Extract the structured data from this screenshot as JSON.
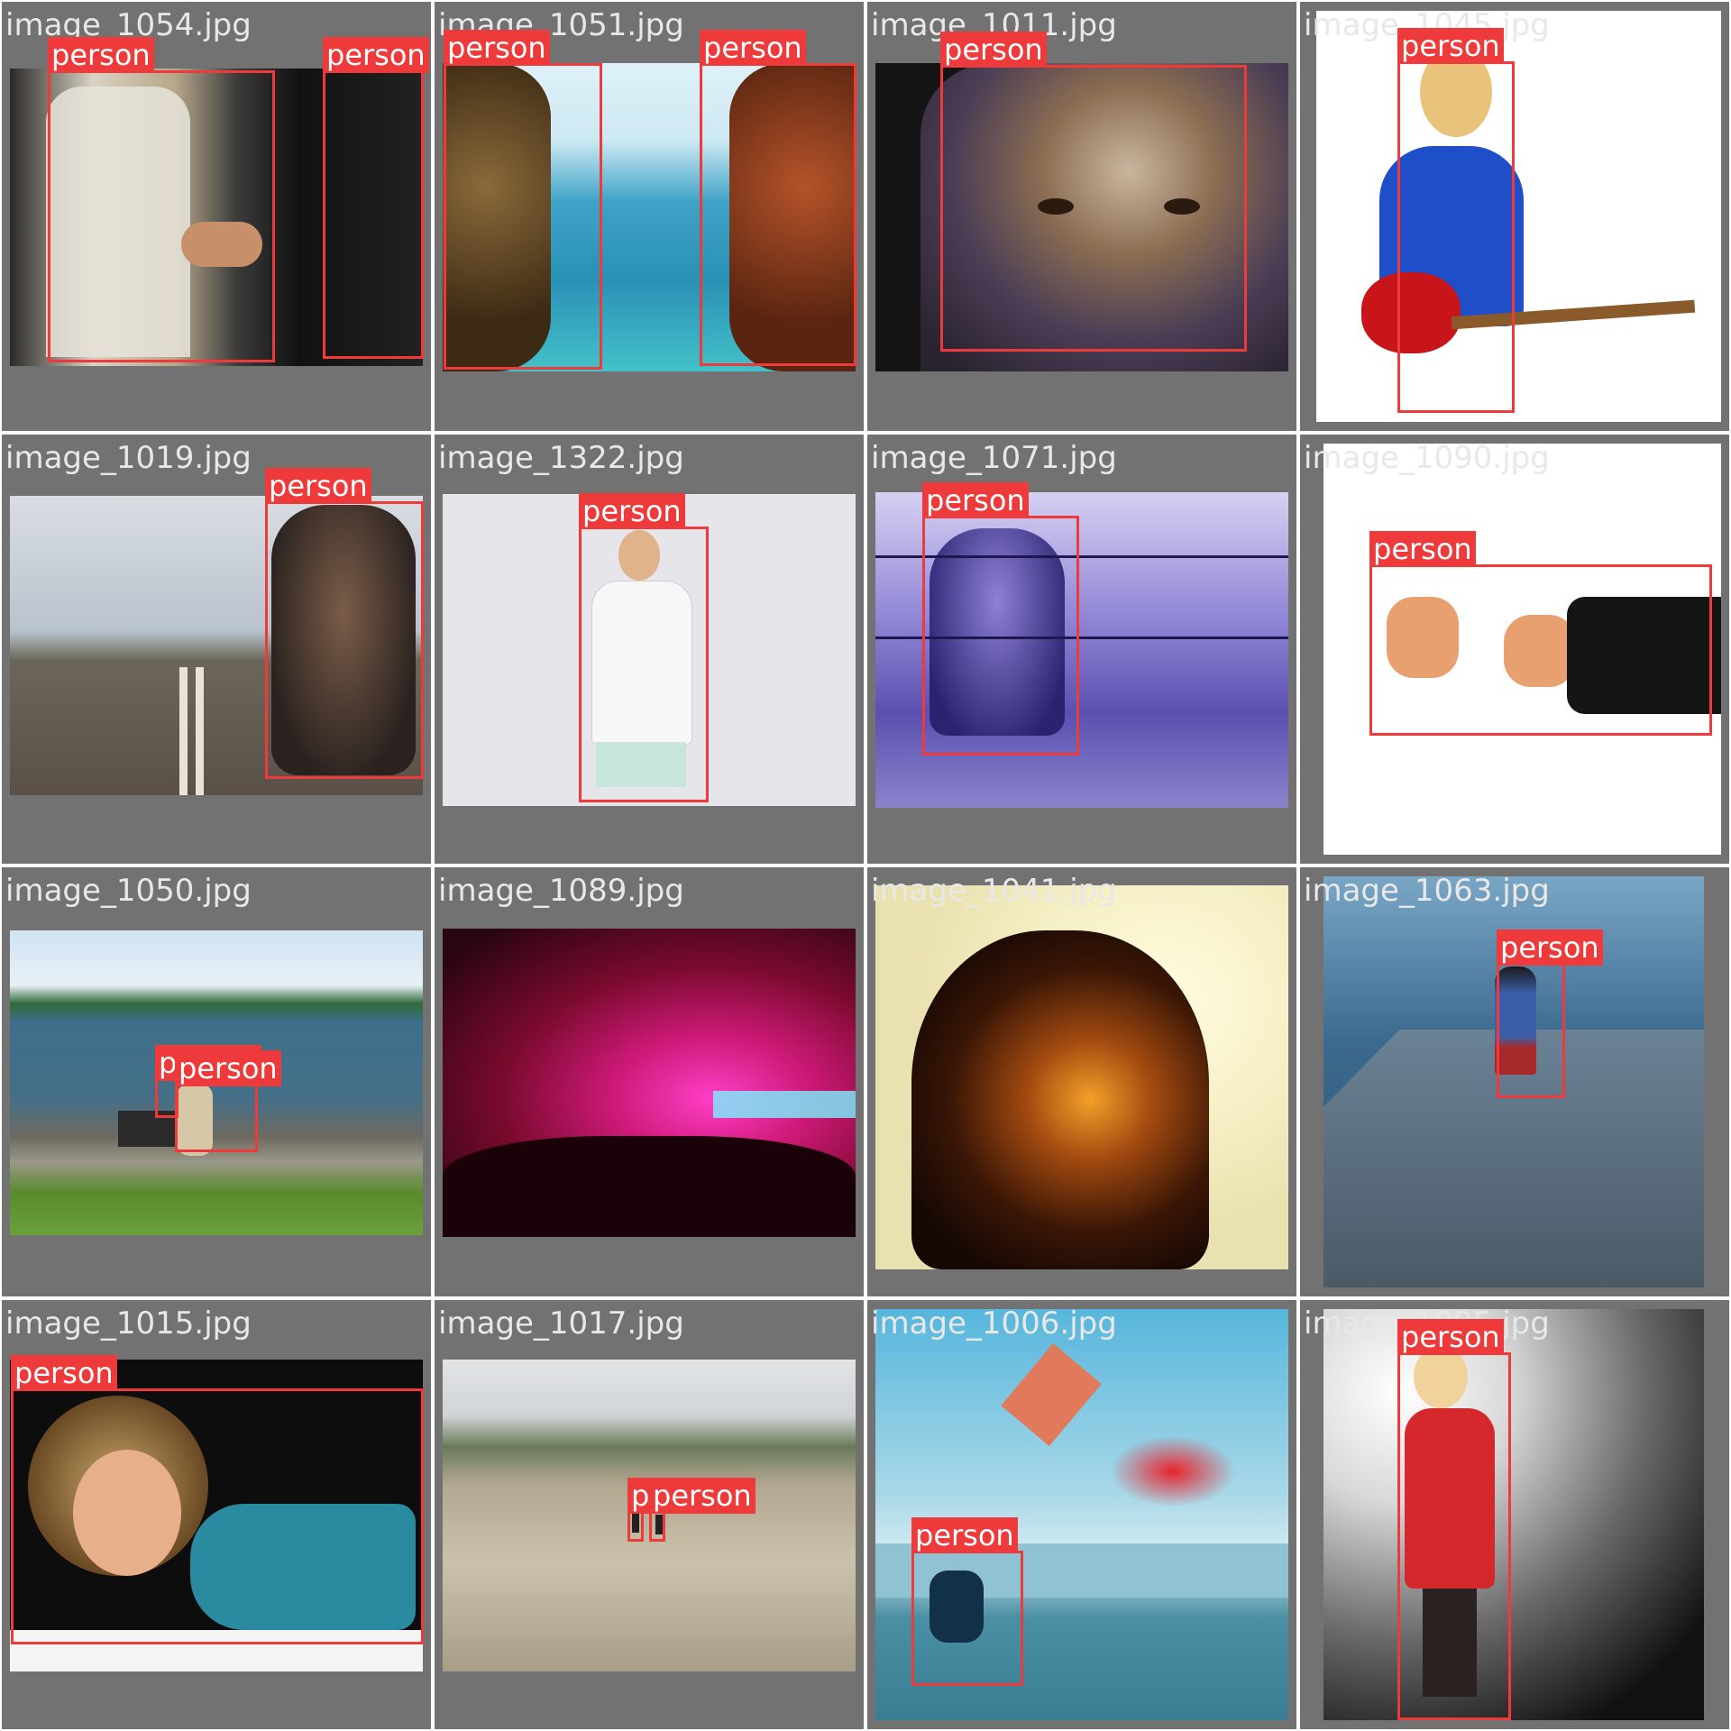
{
  "class_label": "person",
  "colors": {
    "tile_bg": "#727272",
    "box": "#ee3a3a",
    "label_text": "#ffffff",
    "filename_text": "#e8e8e8"
  },
  "tiles": [
    {
      "filename": "image_1054.jpg",
      "scene": "handshake office",
      "detections": [
        "person",
        "person"
      ]
    },
    {
      "filename": "image_1051.jpg",
      "scene": "two heads by the sea",
      "detections": [
        "person",
        "person"
      ]
    },
    {
      "filename": "image_1011.jpg",
      "scene": "veiled face",
      "detections": [
        "person"
      ]
    },
    {
      "filename": "image_1045.jpg",
      "scene": "woman with red guitar",
      "detections": [
        "person"
      ]
    },
    {
      "filename": "image_1019.jpg",
      "scene": "athlete on road",
      "detections": [
        "person"
      ]
    },
    {
      "filename": "image_1322.jpg",
      "scene": "man in white t-shirt",
      "detections": [
        "person"
      ]
    },
    {
      "filename": "image_1071.jpg",
      "scene": "boy behind barbed wire",
      "detections": [
        "person"
      ]
    },
    {
      "filename": "image_1090.jpg",
      "scene": "thumbs up hands",
      "detections": [
        "person"
      ]
    },
    {
      "filename": "image_1050.jpg",
      "scene": "bench by the bay",
      "detections": [
        "person",
        "person"
      ]
    },
    {
      "filename": "image_1089.jpg",
      "scene": "concert crowd",
      "detections": []
    },
    {
      "filename": "image_1041.jpg",
      "scene": "double exposure sunset",
      "detections": []
    },
    {
      "filename": "image_1063.jpg",
      "scene": "child on pier",
      "detections": [
        "person"
      ]
    },
    {
      "filename": "image_1015.jpg",
      "scene": "woman lying down",
      "detections": [
        "person"
      ]
    },
    {
      "filename": "image_1017.jpg",
      "scene": "dunes with hikers",
      "detections": [
        "person",
        "person"
      ]
    },
    {
      "filename": "image_1006.jpg",
      "scene": "kite over city",
      "detections": [
        "person"
      ]
    },
    {
      "filename": "image_1095.jpg",
      "scene": "woman in red dress",
      "detections": [
        "person"
      ]
    }
  ]
}
